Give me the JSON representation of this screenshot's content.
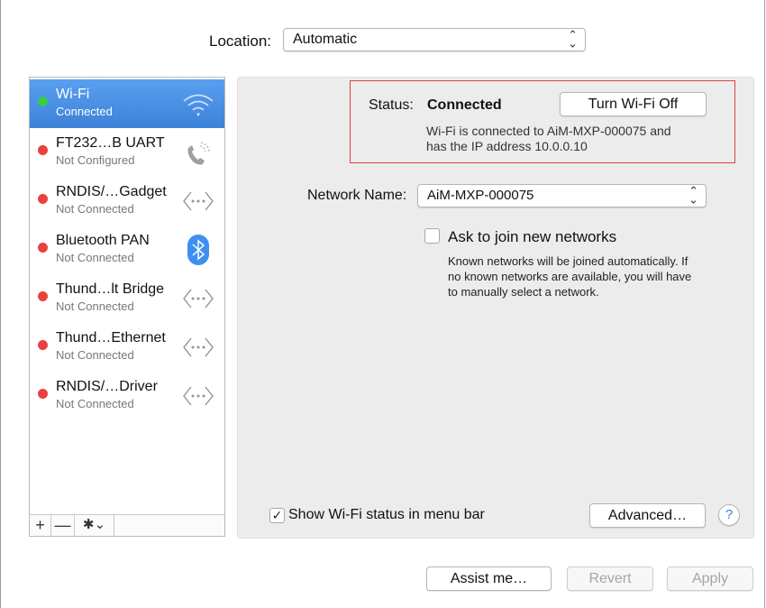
{
  "location": {
    "label": "Location:",
    "value": "Automatic"
  },
  "services": [
    {
      "name": "Wi-Fi",
      "status": "Connected",
      "state_color": "#3bc94a",
      "icon": "wifi-icon",
      "selected": true
    },
    {
      "name": "FT232…B UART",
      "status": "Not Configured",
      "state_color": "#e8423f",
      "icon": "phone-icon"
    },
    {
      "name": "RNDIS/…Gadget",
      "status": "Not Connected",
      "state_color": "#e8423f",
      "icon": "ethernet-arrows-icon"
    },
    {
      "name": "Bluetooth PAN",
      "status": "Not Connected",
      "state_color": "#e8423f",
      "icon": "bluetooth-icon"
    },
    {
      "name": "Thund…lt Bridge",
      "status": "Not Connected",
      "state_color": "#e8423f",
      "icon": "ethernet-arrows-icon"
    },
    {
      "name": "Thund…Ethernet",
      "status": "Not Connected",
      "state_color": "#e8423f",
      "icon": "ethernet-arrows-icon"
    },
    {
      "name": "RNDIS/…Driver",
      "status": "Not Connected",
      "state_color": "#e8423f",
      "icon": "ethernet-arrows-icon"
    }
  ],
  "sidebar_toolbar": {
    "add": "+",
    "remove": "—",
    "actions": "✱⌄"
  },
  "status": {
    "label": "Status:",
    "value": "Connected",
    "toggle_button": "Turn Wi-Fi Off",
    "description_line1": "Wi-Fi is connected to AiM-MXP-000075 and",
    "description_line2": "has the IP address 10.0.0.10"
  },
  "network": {
    "label": "Network Name:",
    "value": "AiM-MXP-000075"
  },
  "ask_join": {
    "label": "Ask to join new networks",
    "checked": false,
    "help_line1": "Known networks will be joined automatically. If",
    "help_line2": "no known networks are available, you will have",
    "help_line3": "to manually select a network."
  },
  "show_status": {
    "label": "Show Wi-Fi status in menu bar",
    "checked": true,
    "check_glyph": "✓"
  },
  "buttons": {
    "advanced": "Advanced…",
    "help": "?",
    "assist": "Assist me…",
    "revert": "Revert",
    "apply": "Apply"
  },
  "colors": {
    "accent": "#3c82d8",
    "highlight_border": "#e0404a",
    "connected": "#3bc94a",
    "disconnected": "#e8423f"
  }
}
